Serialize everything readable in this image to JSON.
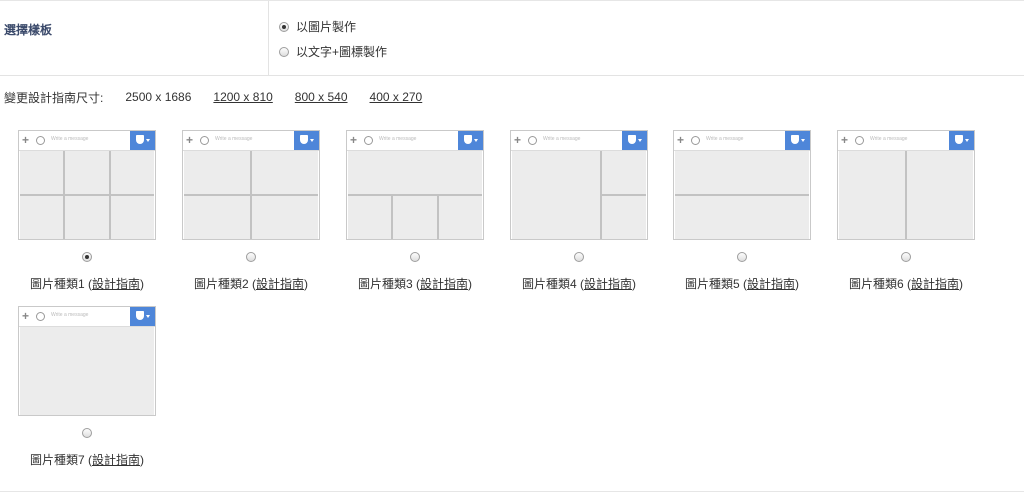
{
  "section": {
    "label": "選擇樣板",
    "options": [
      {
        "label": "以圖片製作",
        "checked": true
      },
      {
        "label": "以文字+圖標製作",
        "checked": false
      }
    ]
  },
  "sizes": {
    "label": "變更設計指南尺寸:",
    "options": [
      {
        "label": "2500 x 1686",
        "selected": true
      },
      {
        "label": "1200 x 810",
        "selected": false
      },
      {
        "label": "800 x 540",
        "selected": false
      },
      {
        "label": "400 x 270",
        "selected": false
      }
    ]
  },
  "thumb": {
    "placeholder": "Write a message",
    "icons": [
      "plus-icon",
      "emoji-icon",
      "shield-icon",
      "caret-down-icon"
    ]
  },
  "templates": [
    {
      "name": "圖片種類1",
      "guide": "設計指南",
      "checked": true
    },
    {
      "name": "圖片種類2",
      "guide": "設計指南",
      "checked": false
    },
    {
      "name": "圖片種類3",
      "guide": "設計指南",
      "checked": false
    },
    {
      "name": "圖片種類4",
      "guide": "設計指南",
      "checked": false
    },
    {
      "name": "圖片種類5",
      "guide": "設計指南",
      "checked": false
    },
    {
      "name": "圖片種類6",
      "guide": "設計指南",
      "checked": false
    },
    {
      "name": "圖片種類7",
      "guide": "設計指南",
      "checked": false
    }
  ],
  "colors": {
    "accent": "#4e86d9",
    "cell": "#ececec",
    "cell_border": "#c2c2c2"
  }
}
